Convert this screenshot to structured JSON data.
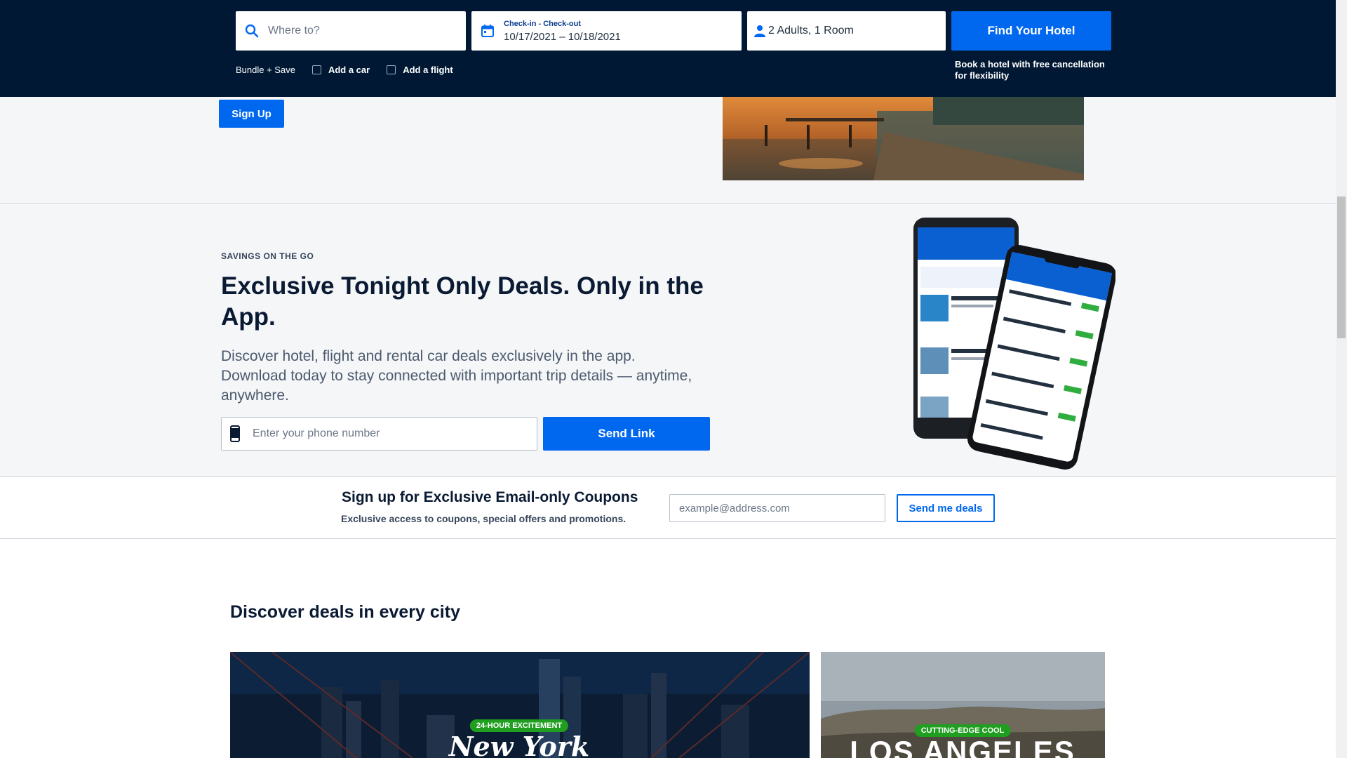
{
  "search": {
    "where_placeholder": "Where to?",
    "dates_label": "Check-in - Check-out",
    "dates_value": "10/17/2021 – 10/18/2021",
    "guests_value": "2 Adults, 1 Room",
    "find_button": "Find Your Hotel",
    "bundle_label": "Bundle + Save",
    "add_car": "Add a car",
    "add_flight": "Add a flight",
    "free_cancel_note": "Book a hotel with free cancellation for flexibility"
  },
  "top_band": {
    "signup_button": "Sign Up"
  },
  "app_section": {
    "eyebrow": "SAVINGS ON THE GO",
    "title": "Exclusive Tonight Only Deals. Only in the App.",
    "description": "Discover hotel, flight and rental car deals exclusively in the app. Download today to stay connected with important trip details — anytime, anywhere.",
    "phone_placeholder": "Enter your phone number",
    "send_button": "Send Link"
  },
  "email_band": {
    "title": "Sign up for Exclusive Email-only Coupons",
    "subtitle": "Exclusive access to coupons, special offers and promotions.",
    "email_placeholder": "example@address.com",
    "button": "Send me deals"
  },
  "deals": {
    "title": "Discover deals in every city",
    "cards": [
      {
        "badge": "24-HOUR EXCITEMENT",
        "city": "New York"
      },
      {
        "badge": "CUTTING-EDGE COOL",
        "city": "LOS ANGELES"
      }
    ]
  },
  "colors": {
    "header_bg": "#001833",
    "primary": "#0068ef",
    "badge_green": "#1f9e1f",
    "section_bg": "#f4f6f8"
  }
}
